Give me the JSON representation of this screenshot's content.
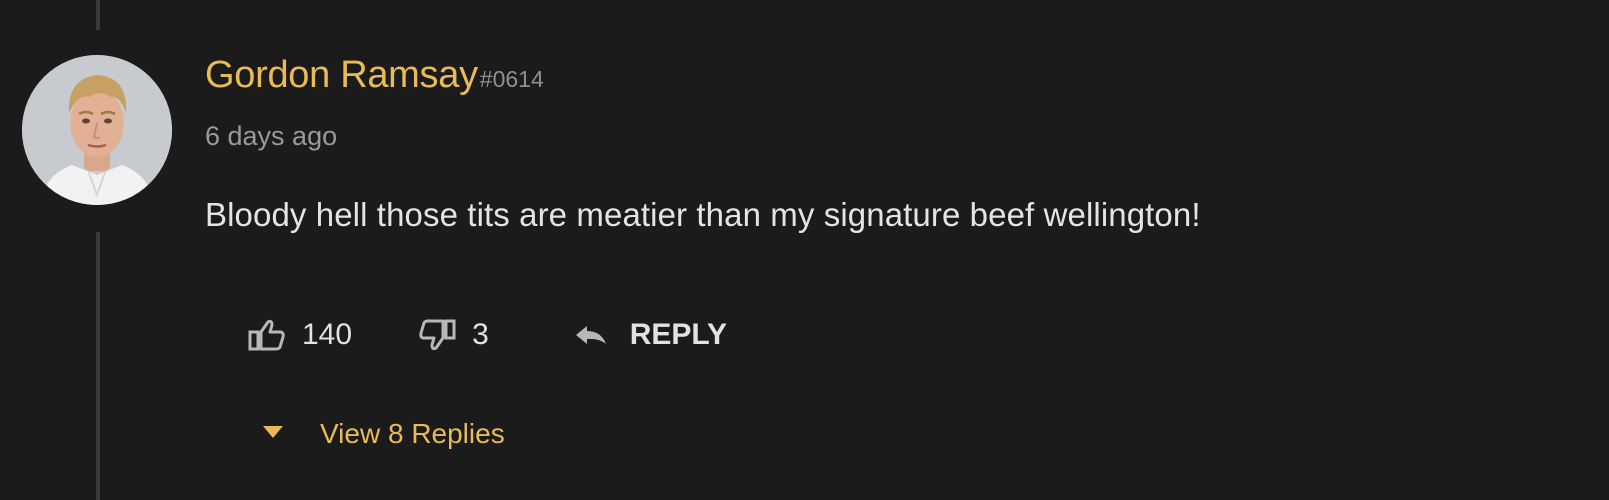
{
  "comment": {
    "author": {
      "name": "Gordon Ramsay",
      "tag": "#0614"
    },
    "timestamp": "6 days ago",
    "text": "Bloody hell those tits are meatier than my signature beef wellington!",
    "actions": {
      "likes": "140",
      "dislikes": "3",
      "reply_label": "REPLY"
    },
    "view_replies_label": "View 8 Replies"
  },
  "icons": {
    "like": "thumbs-up-icon",
    "dislike": "thumbs-down-icon",
    "reply": "reply-arrow-icon",
    "expand": "caret-down-icon"
  },
  "colors": {
    "background": "#1b1b1b",
    "username": "#e8ba58",
    "view_replies": "#e8ba58",
    "body_text": "#e4e4e4",
    "muted_text": "#9a9a9a",
    "thread_line": "#3a3a3a"
  }
}
